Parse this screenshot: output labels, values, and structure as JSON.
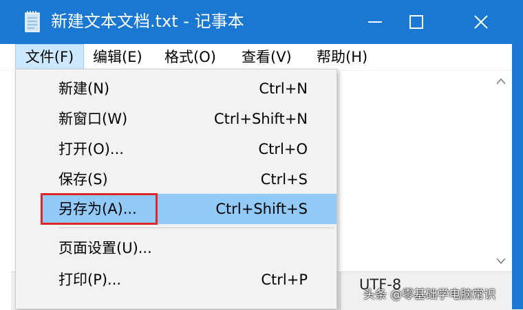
{
  "window": {
    "title": "新建文本文档.txt - 记事本"
  },
  "menubar": [
    {
      "label": "文件(F)"
    },
    {
      "label": "编辑(E)"
    },
    {
      "label": "格式(O)"
    },
    {
      "label": "查看(V)"
    },
    {
      "label": "帮助(H)"
    }
  ],
  "file_menu": {
    "items": [
      {
        "label": "新建(N)",
        "shortcut": "Ctrl+N"
      },
      {
        "label": "新窗口(W)",
        "shortcut": "Ctrl+Shift+N"
      },
      {
        "label": "打开(O)...",
        "shortcut": "Ctrl+O"
      },
      {
        "label": "保存(S)",
        "shortcut": "Ctrl+S"
      },
      {
        "label": "另存为(A)...",
        "shortcut": "Ctrl+Shift+S"
      },
      {
        "label": "页面设置(U)...",
        "shortcut": ""
      },
      {
        "label": "打印(P)...",
        "shortcut": "Ctrl+P"
      }
    ],
    "highlighted_index": 4
  },
  "status": {
    "encoding": "UTF-8"
  },
  "watermark": "头条 @零基础学电脑常识",
  "colors": {
    "titlebar": "#1b78d2",
    "highlight": "#91c9f7",
    "annotation": "#e02626"
  }
}
